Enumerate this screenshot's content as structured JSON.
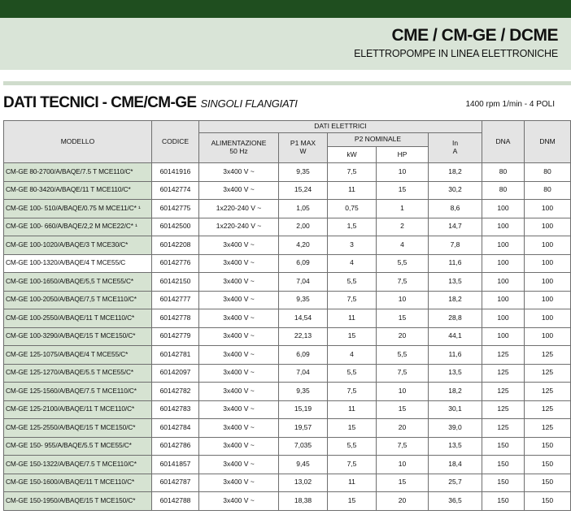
{
  "header": {
    "title": "CME / CM-GE / DCME",
    "subtitle": "ELETTROPOMPE IN LINEA ELETTRONICHE"
  },
  "section": {
    "title": "DATI TECNICI - CME/CM-GE",
    "subtitle": "SINGOLI FLANGIATI",
    "rpm_note": "1400 rpm 1/min - 4 POLI"
  },
  "table": {
    "headers": {
      "modello": "MODELLO",
      "codice": "CODICE",
      "dati_elettrici": "DATI ELETTRICI",
      "alimentazione": "ALIMENTAZIONE",
      "alimentazione_unit": "50 Hz",
      "p1": "P1 MAX",
      "p1_unit": "W",
      "p2": "P2 NOMINALE",
      "kw": "kW",
      "hp": "HP",
      "in": "In",
      "in_unit": "A",
      "dna": "DNA",
      "dnm": "DNM"
    },
    "rows": [
      {
        "model": "CM-GE 80-2700/A/BAQE/7.5 T MCE110/C*",
        "code": "60141916",
        "supply": "3x400 V ~",
        "p1": "9,35",
        "kw": "7,5",
        "hp": "10",
        "in": "18,2",
        "dna": "80",
        "dnm": "80"
      },
      {
        "model": "CM-GE 80-3420/A/BAQE/11 T MCE110/C*",
        "code": "60142774",
        "supply": "3x400 V ~",
        "p1": "15,24",
        "kw": "11",
        "hp": "15",
        "in": "30,2",
        "dna": "80",
        "dnm": "80"
      },
      {
        "model": "CM-GE 100- 510/A/BAQE/0.75 M MCE11/C* ¹",
        "code": "60142775",
        "supply": "1x220-240 V ~",
        "p1": "1,05",
        "kw": "0,75",
        "hp": "1",
        "in": "8,6",
        "dna": "100",
        "dnm": "100"
      },
      {
        "model": "CM-GE 100- 660/A/BAQE/2,2 M MCE22/C* ¹",
        "code": "60142500",
        "supply": "1x220-240 V ~",
        "p1": "2,00",
        "kw": "1,5",
        "hp": "2",
        "in": "14,7",
        "dna": "100",
        "dnm": "100"
      },
      {
        "model": "CM-GE 100-1020/A/BAQE/3 T MCE30/C*",
        "code": "60142208",
        "supply": "3x400 V ~",
        "p1": "4,20",
        "kw": "3",
        "hp": "4",
        "in": "7,8",
        "dna": "100",
        "dnm": "100"
      },
      {
        "model": "CM-GE 100-1320/A/BAQE/4 T MCE55/C",
        "code": "60142776",
        "supply": "3x400 V ~",
        "p1": "6,09",
        "kw": "4",
        "hp": "5,5",
        "in": "11,6",
        "dna": "100",
        "dnm": "100",
        "plain": true
      },
      {
        "model": "CM-GE 100-1650/A/BAQE/5,5 T MCE55/C*",
        "code": "60142150",
        "supply": "3x400 V ~",
        "p1": "7,04",
        "kw": "5,5",
        "hp": "7,5",
        "in": "13,5",
        "dna": "100",
        "dnm": "100"
      },
      {
        "model": "CM-GE 100-2050/A/BAQE/7,5 T MCE110/C*",
        "code": "60142777",
        "supply": "3x400 V ~",
        "p1": "9,35",
        "kw": "7,5",
        "hp": "10",
        "in": "18,2",
        "dna": "100",
        "dnm": "100"
      },
      {
        "model": "CM-GE 100-2550/A/BAQE/11 T MCE110/C*",
        "code": "60142778",
        "supply": "3x400 V ~",
        "p1": "14,54",
        "kw": "11",
        "hp": "15",
        "in": "28,8",
        "dna": "100",
        "dnm": "100"
      },
      {
        "model": "CM-GE 100-3290/A/BAQE/15 T MCE150/C*",
        "code": "60142779",
        "supply": "3x400 V ~",
        "p1": "22,13",
        "kw": "15",
        "hp": "20",
        "in": "44,1",
        "dna": "100",
        "dnm": "100"
      },
      {
        "model": "CM-GE 125-1075/A/BAQE/4 T MCE55/C*",
        "code": "60142781",
        "supply": "3x400 V ~",
        "p1": "6,09",
        "kw": "4",
        "hp": "5,5",
        "in": "11,6",
        "dna": "125",
        "dnm": "125"
      },
      {
        "model": "CM-GE 125-1270/A/BAQE/5.5 T MCE55/C*",
        "code": "60142097",
        "supply": "3x400 V ~",
        "p1": "7,04",
        "kw": "5,5",
        "hp": "7,5",
        "in": "13,5",
        "dna": "125",
        "dnm": "125"
      },
      {
        "model": "CM-GE 125-1560/A/BAQE/7.5 T MCE110/C*",
        "code": "60142782",
        "supply": "3x400 V ~",
        "p1": "9,35",
        "kw": "7,5",
        "hp": "10",
        "in": "18,2",
        "dna": "125",
        "dnm": "125"
      },
      {
        "model": "CM-GE 125-2100/A/BAQE/11 T MCE110/C*",
        "code": "60142783",
        "supply": "3x400 V ~",
        "p1": "15,19",
        "kw": "11",
        "hp": "15",
        "in": "30,1",
        "dna": "125",
        "dnm": "125"
      },
      {
        "model": "CM-GE 125-2550/A/BAQE/15 T MCE150/C*",
        "code": "60142784",
        "supply": "3x400 V ~",
        "p1": "19,57",
        "kw": "15",
        "hp": "20",
        "in": "39,0",
        "dna": "125",
        "dnm": "125"
      },
      {
        "model": "CM-GE 150- 955/A/BAQE/5.5 T MCE55/C*",
        "code": "60142786",
        "supply": "3x400 V ~",
        "p1": "7,035",
        "kw": "5,5",
        "hp": "7,5",
        "in": "13,5",
        "dna": "150",
        "dnm": "150"
      },
      {
        "model": " CM-GE 150-1322/A/BAQE/7.5 T MCE110/C*",
        "code": "60141857",
        "supply": "3x400 V ~",
        "p1": "9,45",
        "kw": "7,5",
        "hp": "10",
        "in": "18,4",
        "dna": "150",
        "dnm": "150"
      },
      {
        "model": " CM-GE 150-1600/A/BAQE/11 T MCE110/C*",
        "code": "60142787",
        "supply": "3x400 V ~",
        "p1": "13,02",
        "kw": "11",
        "hp": "15",
        "in": "25,7",
        "dna": "150",
        "dnm": "150"
      },
      {
        "model": " CM-GE 150-1950/A/BAQE/15 T MCE150/C*",
        "code": "60142788",
        "supply": "3x400 V ~",
        "p1": "18,38",
        "kw": "15",
        "hp": "20",
        "in": "36,5",
        "dna": "150",
        "dnm": "150"
      }
    ]
  }
}
